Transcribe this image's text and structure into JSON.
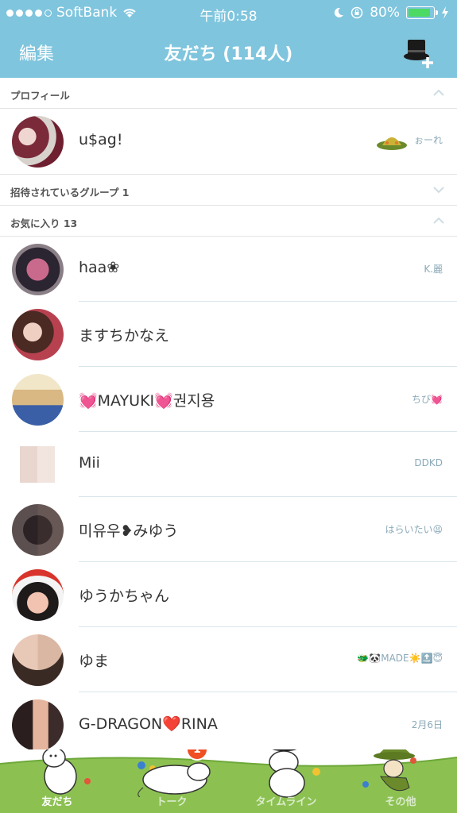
{
  "status_bar": {
    "carrier": "SoftBank",
    "time": "午前0:58",
    "battery": "80%",
    "battery_level": 0.8
  },
  "header": {
    "edit_label": "編集",
    "title": "友だち (114人)",
    "add_icon": "top-hat-add-icon"
  },
  "sections": {
    "profile": {
      "label": "プロフィール"
    },
    "invited_groups": {
      "label": "招待されているグループ 1"
    },
    "favorites": {
      "label": "お気に入り 13"
    }
  },
  "profile": {
    "name": "u$ag!",
    "status": "ぉーれ"
  },
  "favorites": [
    {
      "name": "haa❀",
      "status": "K.麗"
    },
    {
      "name": "ますちかなえ",
      "status": ""
    },
    {
      "name": "💓MAYUKI💓권지용",
      "status": "ちび💓"
    },
    {
      "name": "Mii",
      "status": "DDKD"
    },
    {
      "name": "미유우❥みゆう",
      "status": "はらいたい😫"
    },
    {
      "name": "ゆうかちゃん",
      "status": ""
    },
    {
      "name": "ゆま",
      "status": "🐲🐼MADE☀️🔝😇"
    },
    {
      "name": "G-DRAGON❤️RINA",
      "status": "2月6日"
    }
  ],
  "tabs": [
    {
      "label": "友だち",
      "active": true
    },
    {
      "label": "トーク",
      "active": false,
      "badge": "1"
    },
    {
      "label": "タイムライン",
      "active": false
    },
    {
      "label": "その他",
      "active": false
    }
  ],
  "colors": {
    "header_bg": "#7fc5de",
    "tabbar_grass": "#8cc152",
    "badge": "#f04e23"
  }
}
